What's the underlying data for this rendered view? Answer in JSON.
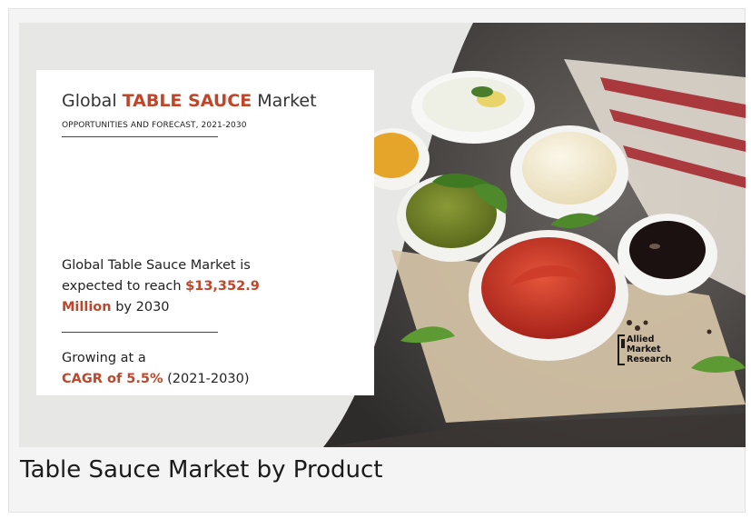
{
  "banner": {
    "title_prefix": "Global",
    "title_strong": "TABLE SAUCE",
    "title_suffix": "Market",
    "subtitle": "OPPORTUNITIES AND FORECAST, 2021-2030",
    "stat_line1": "Global Table Sauce Market is",
    "stat_line2": "expected to reach",
    "stat_value": "$13,352.9",
    "stat_unit": "Million",
    "stat_tail": "by 2030",
    "growth_line": "Growing at a",
    "growth_cagr": "CAGR of 5.5%",
    "growth_period": "(2021-2030)",
    "logo": [
      "Allied",
      "Market",
      "Research"
    ],
    "accent_color": "#c0462a"
  },
  "caption": "Table Sauce Market by Product"
}
